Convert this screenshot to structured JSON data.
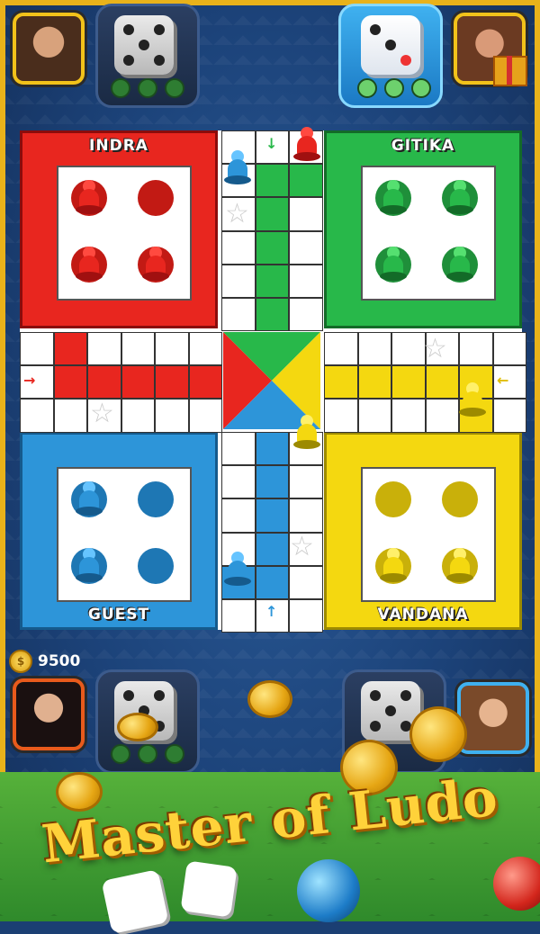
{
  "players": {
    "top_left": {
      "name": "INDRA",
      "die_value": 5
    },
    "top_right": {
      "name": "GITIKA",
      "die_value": 3,
      "active": true
    },
    "bottom_left": {
      "name": "GUEST",
      "die_value": 5
    },
    "bottom_right": {
      "name": "VANDANA",
      "die_value": 5
    }
  },
  "colors": {
    "red": "#e8261f",
    "green": "#28b84a",
    "blue": "#2d95d9",
    "yellow": "#f4d810"
  },
  "hud": {
    "coins": "9500",
    "coin_symbol": "$"
  },
  "banner": {
    "title": "Master of Ludo"
  }
}
